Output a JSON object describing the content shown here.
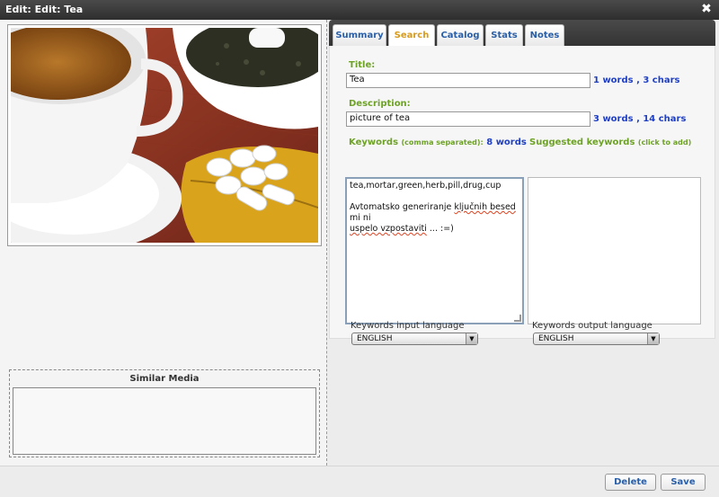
{
  "window": {
    "title": "Edit: Edit: Tea"
  },
  "similar_media": {
    "title": "Similar Media"
  },
  "tabs": [
    {
      "label": "Summary"
    },
    {
      "label": "Search"
    },
    {
      "label": "Catalog"
    },
    {
      "label": "Stats"
    },
    {
      "label": "Notes"
    }
  ],
  "active_tab": "Search",
  "form": {
    "title_label": "Title:",
    "title_value": "Tea",
    "title_count": "1 words , 3 chars",
    "description_label": "Description:",
    "description_value": "picture of tea",
    "description_count": "3 words , 14 chars",
    "keywords_label": "Keywords",
    "keywords_hint": "(comma separated):",
    "keywords_count": "8 words",
    "keywords_line1": "tea,mortar,green,herb,pill,drug,cup",
    "keywords_line2_a": "Avtomatsko generiranje ",
    "keywords_line2_b": "ključnih besed",
    "keywords_line2_c": " mi ni",
    "keywords_line3_a": "uspelo vzpostaviti",
    "keywords_line3_b": " ... :=)",
    "suggested_label": "Suggested keywords",
    "suggested_hint": "(click to add)",
    "input_lang_label": "Keywords input language",
    "input_lang_value": "ENGLISH",
    "output_lang_label": "Keywords output language",
    "output_lang_value": "ENGLISH"
  },
  "footer": {
    "delete_label": "Delete",
    "save_label": "Save"
  },
  "colors": {
    "accent_green": "#6ea227",
    "count_blue": "#1f3fc4",
    "tab_active": "#d89a1a",
    "tab_text": "#2a5fa8"
  }
}
